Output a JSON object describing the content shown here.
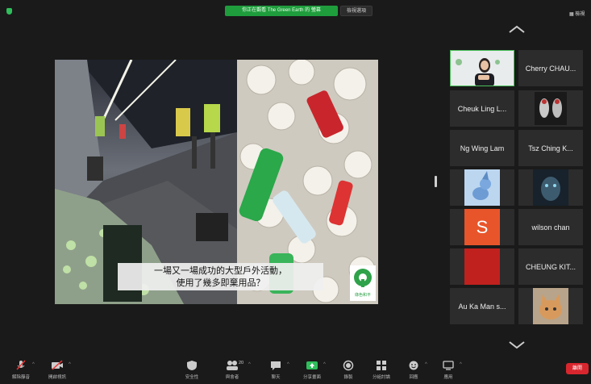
{
  "top_bar": {
    "share_banner": "你正在觀看 The Green Earth 的 螢幕",
    "stop_share": "檢視選項",
    "view_label": "檢視"
  },
  "slide": {
    "caption_line1": "一場又一場成功的大型戶外活動，",
    "caption_line2": "使用了幾多即棄用品？",
    "logo_text": "綠色和平"
  },
  "gallery": {
    "participants": [
      {
        "name": "",
        "video": true
      },
      {
        "name": "Cherry CHAU...",
        "video": false
      },
      {
        "name": "Cheuk Ling L...",
        "video": false
      },
      {
        "name": "",
        "video": true
      },
      {
        "name": "Ng Wing Lam",
        "video": false
      },
      {
        "name": "Tsz Ching K...",
        "video": false
      },
      {
        "name": "",
        "video": true
      },
      {
        "name": "",
        "video": true
      },
      {
        "name": "",
        "avatar_letter": "S"
      },
      {
        "name": "wilson chan",
        "video": false
      },
      {
        "name": "",
        "video": true
      },
      {
        "name": "CHEUNG KIT...",
        "video": false
      },
      {
        "name": "Au Ka Man s...",
        "video": false
      },
      {
        "name": "",
        "video": true
      }
    ]
  },
  "toolbar": {
    "unmute": "解除靜音",
    "start_video": "開啟視訊",
    "security": "安全性",
    "participants": "與會者",
    "participants_count": "20",
    "chat": "聊天",
    "share_screen": "分享畫面",
    "record": "錄製",
    "breakout": "分組討論",
    "reactions": "回應",
    "apps": "應用",
    "end": "離開"
  },
  "colors": {
    "share_green": "#1f9d3d",
    "end_red": "#d8262e",
    "avatar_orange": "#e8552b"
  }
}
